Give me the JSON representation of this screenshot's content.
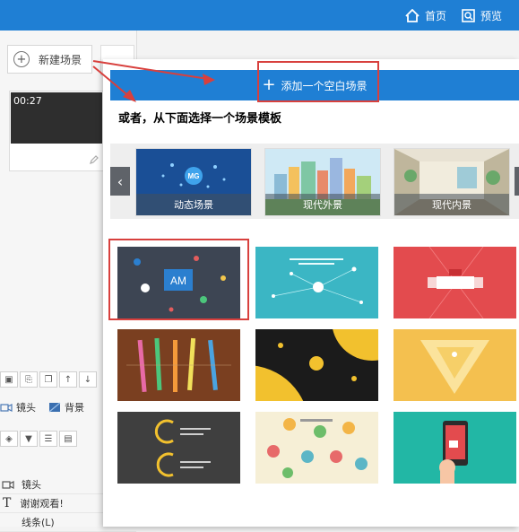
{
  "header": {
    "home_label": "首页",
    "preview_label": "预览",
    "bar_color": "#1f7fd4"
  },
  "left_panel": {
    "new_scene_label": "新建场景",
    "scene_time": "00:27",
    "tabs": [
      {
        "icon": "camera-icon",
        "label": "镜头"
      },
      {
        "icon": "background-icon",
        "label": "背景"
      }
    ],
    "list": [
      {
        "icon": "camera-icon",
        "label": "镜头"
      },
      {
        "icon": "text-icon",
        "label": "谢谢观看!"
      },
      {
        "icon": "",
        "label": "线条(L)"
      }
    ]
  },
  "popup": {
    "add_blank_label": "添加一个空白场景",
    "or_text": "或者，从下面选择一个场景模板",
    "categories": [
      {
        "label": "动态场景",
        "badge": "MG"
      },
      {
        "label": "现代外景"
      },
      {
        "label": "现代内景"
      }
    ],
    "templates": [
      {
        "name": "template-am",
        "text": "AM"
      },
      {
        "name": "template-network"
      },
      {
        "name": "template-ribbon"
      },
      {
        "name": "template-pencils"
      },
      {
        "name": "template-circles"
      },
      {
        "name": "template-triangle"
      },
      {
        "name": "template-text-circles"
      },
      {
        "name": "template-people"
      },
      {
        "name": "template-phone"
      }
    ]
  },
  "annotation_color": "#d8403d"
}
